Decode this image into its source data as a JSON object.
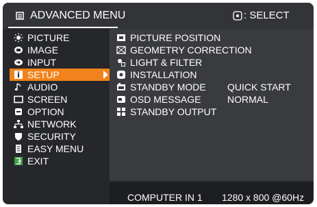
{
  "header": {
    "title": "ADVANCED MENU",
    "select_hint": ": SELECT",
    "icons": {
      "menu": "menu-icon",
      "select": "select-pad-icon"
    }
  },
  "sidebar": {
    "items": [
      {
        "label": "PICTURE",
        "icon": "sun-icon"
      },
      {
        "label": "IMAGE",
        "icon": "image-icon"
      },
      {
        "label": "INPUT",
        "icon": "input-icon"
      },
      {
        "label": "SETUP",
        "icon": "setup-icon",
        "active": true
      },
      {
        "label": "AUDIO",
        "icon": "note-icon"
      },
      {
        "label": "SCREEN",
        "icon": "screen-icon"
      },
      {
        "label": "OPTION",
        "icon": "option-icon"
      },
      {
        "label": "NETWORK",
        "icon": "network-icon"
      },
      {
        "label": "SECURITY",
        "icon": "shield-icon"
      },
      {
        "label": "EASY MENU",
        "icon": "easy-menu-icon"
      },
      {
        "label": "EXIT",
        "icon": "exit-icon"
      }
    ]
  },
  "submenu": {
    "items": [
      {
        "label": "PICTURE POSITION",
        "value": "",
        "icon": "picture-position-icon"
      },
      {
        "label": "GEOMETRY CORRECTION",
        "value": "",
        "icon": "geometry-icon"
      },
      {
        "label": "LIGHT & FILTER",
        "value": "",
        "icon": "light-filter-icon"
      },
      {
        "label": "INSTALLATION",
        "value": "",
        "icon": "installation-icon"
      },
      {
        "label": "STANDBY MODE",
        "value": "QUICK START",
        "icon": "standby-mode-icon"
      },
      {
        "label": "OSD MESSAGE",
        "value": "NORMAL",
        "icon": "osd-message-icon"
      },
      {
        "label": "STANDBY OUTPUT",
        "value": "",
        "icon": "standby-output-icon"
      }
    ]
  },
  "status": {
    "source": "COMPUTER IN 1",
    "resolution": "1280 x 800 @60Hz"
  },
  "colors": {
    "accent": "#f0831c",
    "panel": "#3a3b3f",
    "background": "#26272b"
  }
}
